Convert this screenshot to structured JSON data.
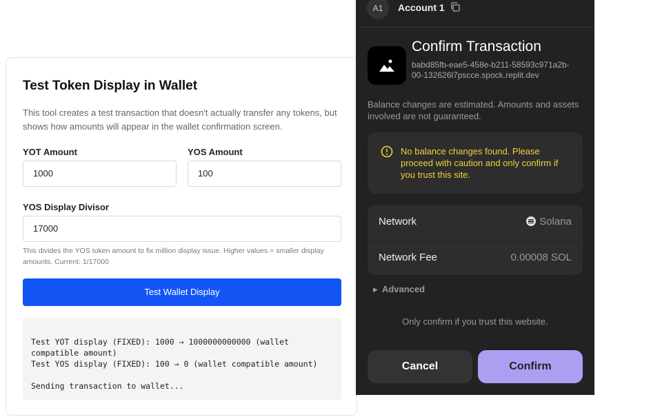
{
  "test_card": {
    "title": "Test Token Display in Wallet",
    "description": "This tool creates a test transaction that doesn't actually transfer any tokens, but shows how amounts will appear in the wallet confirmation screen.",
    "yot_label": "YOT Amount",
    "yot_value": "1000",
    "yos_label": "YOS Amount",
    "yos_value": "100",
    "divisor_label": "YOS Display Divisor",
    "divisor_value": "17000",
    "hint": "This divides the YOS token amount to fix million display issue. Higher values = smaller display amounts. Current: 1/17000",
    "button_label": "Test Wallet Display",
    "log_lines": [
      "Test YOT display (FIXED): 1000 → 1000000000000 (wallet compatible amount)",
      "Test YOS display (FIXED): 100 → 0 (wallet compatible amount)",
      "",
      "Sending transaction to wallet..."
    ]
  },
  "wallet": {
    "account_avatar": "A1",
    "account_name": "Account 1",
    "account_copy_icon": "copy-icon",
    "title": "Confirm Transaction",
    "origin": "babd85fb-eae5-458e-b211-58593c971a2b-00-132626l7pscce.spock.replit.dev",
    "estimate_note": "Balance changes are estimated. Amounts and assets involved are not guaranteed.",
    "warning_icon": "info-circle-icon",
    "warning": "No balance changes found. Please proceed with caution and only confirm if you trust this site.",
    "network_label": "Network",
    "network_value": "Solana",
    "fee_label": "Network Fee",
    "fee_value": "0.00008 SOL",
    "advanced_label": "Advanced",
    "trust_note": "Only confirm if you trust this website.",
    "cancel_label": "Cancel",
    "confirm_label": "Confirm",
    "colors": {
      "panel_bg": "#222222",
      "card_bg": "#2d2d2d",
      "warning": "#f2d13a",
      "confirm_bg": "#ab9ff2",
      "primary_blue": "#1355f5"
    }
  }
}
